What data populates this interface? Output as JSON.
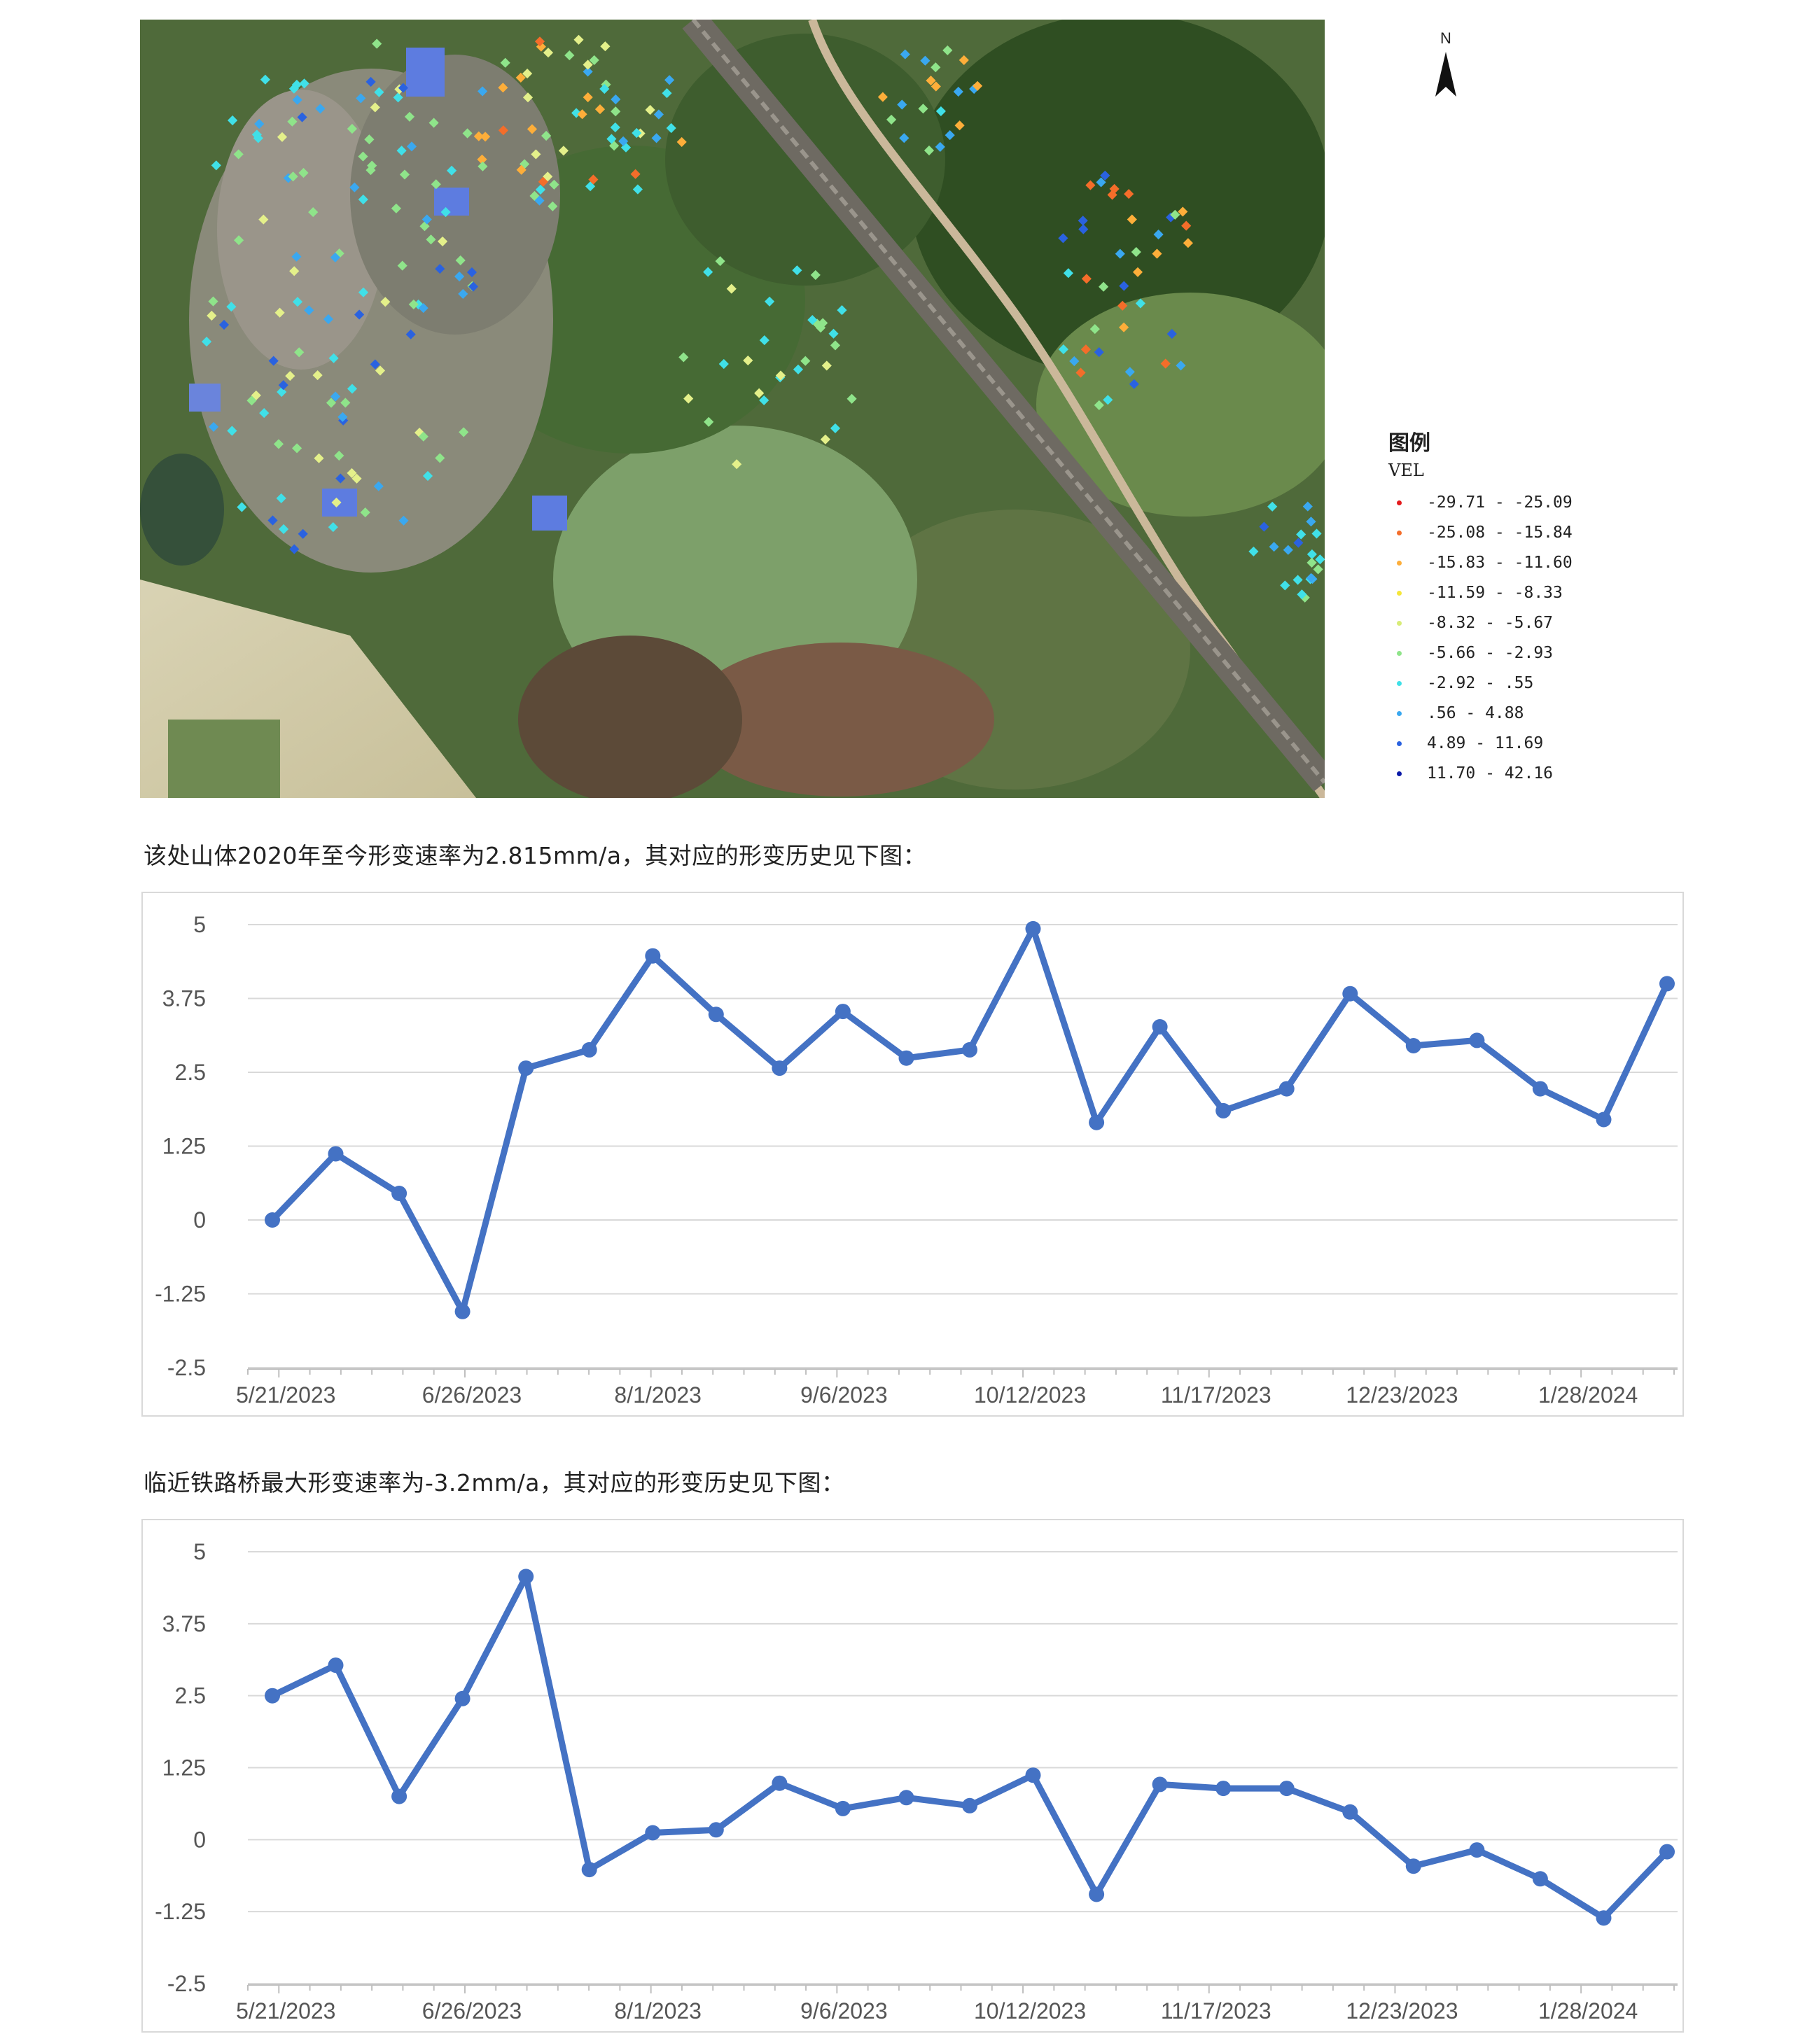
{
  "map": {
    "colors": [
      "#e41a1c",
      "#f46d2a",
      "#fdae3a",
      "#ffee3a",
      "#e4f08a",
      "#8fe48a",
      "#40e0e8",
      "#3aa8f0",
      "#2a62e0",
      "#0a1aa8"
    ]
  },
  "north_arrow": {
    "label": "N"
  },
  "legend": {
    "title": "图例",
    "subtitle": "VEL",
    "items": [
      {
        "label": "-29.71 - -25.09",
        "color": "#e41a1c"
      },
      {
        "label": "-25.08 - -15.84",
        "color": "#f46d2a"
      },
      {
        "label": "-15.83 - -11.60",
        "color": "#fdae3a"
      },
      {
        "label": "-11.59 - -8.33",
        "color": "#f5e63a"
      },
      {
        "label": "-8.32 - -5.67",
        "color": "#d8ec78"
      },
      {
        "label": "-5.66 - -2.93",
        "color": "#8fe48a"
      },
      {
        "label": "-2.92 - .55",
        "color": "#40e0e8"
      },
      {
        "label": ".56 - 4.88",
        "color": "#3aa8f0"
      },
      {
        "label": "4.89 - 11.69",
        "color": "#2a62e0"
      },
      {
        "label": "11.70 - 42.16",
        "color": "#0a1aa8"
      }
    ]
  },
  "captions": {
    "first": "该处山体2020年至今形变速率为2.815mm/a，其对应的形变历史见下图：",
    "second": "临近铁路桥最大形变速率为-3.2mm/a，其对应的形变历史见下图："
  },
  "chart_data": [
    {
      "type": "line",
      "title": "",
      "xlabel": "",
      "ylabel": "",
      "ylim": [
        -2.5,
        5
      ],
      "yticks": [
        "5",
        "3.75",
        "2.5",
        "1.25",
        "0",
        "-1.25",
        "-2.5"
      ],
      "xtick_labels": [
        "5/21/2023",
        "6/26/2023",
        "8/1/2023",
        "9/6/2023",
        "10/12/2023",
        "11/17/2023",
        "12/23/2023",
        "1/28/2024"
      ],
      "grid": true,
      "color": "#4472c4",
      "series": [
        {
          "values": [
            0.0,
            1.12,
            0.45,
            -1.55,
            2.57,
            2.88,
            4.47,
            3.48,
            2.57,
            3.53,
            2.74,
            2.88,
            4.93,
            1.65,
            3.27,
            1.85,
            2.22,
            3.83,
            2.95,
            3.04,
            2.22,
            1.7,
            4.0
          ]
        }
      ]
    },
    {
      "type": "line",
      "title": "",
      "xlabel": "",
      "ylabel": "",
      "ylim": [
        -2.5,
        5
      ],
      "yticks": [
        "5",
        "3.75",
        "2.5",
        "1.25",
        "0",
        "-1.25",
        "-2.5"
      ],
      "xtick_labels": [
        "5/21/2023",
        "6/26/2023",
        "8/1/2023",
        "9/6/2023",
        "10/12/2023",
        "11/17/2023",
        "12/23/2023",
        "1/28/2024"
      ],
      "grid": true,
      "color": "#4472c4",
      "series": [
        {
          "values": [
            2.5,
            3.03,
            0.75,
            2.45,
            4.57,
            -0.52,
            0.12,
            0.17,
            0.98,
            0.54,
            0.73,
            0.59,
            1.12,
            -0.95,
            0.96,
            0.89,
            0.89,
            0.48,
            -0.46,
            -0.18,
            -0.68,
            -1.36,
            -0.21
          ]
        }
      ]
    }
  ]
}
